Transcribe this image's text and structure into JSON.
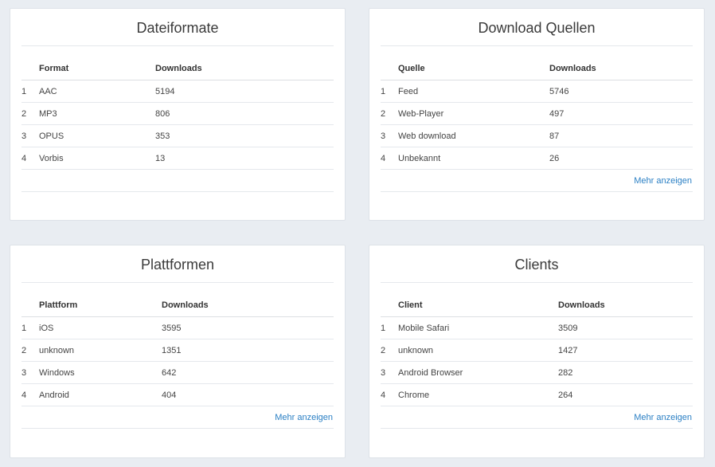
{
  "cards": [
    {
      "title": "Dateiformate",
      "columns": [
        "Format",
        "Downloads"
      ],
      "rows": [
        {
          "rank": "1",
          "name": "AAC",
          "downloads": "5194"
        },
        {
          "rank": "2",
          "name": "MP3",
          "downloads": "806"
        },
        {
          "rank": "3",
          "name": "OPUS",
          "downloads": "353"
        },
        {
          "rank": "4",
          "name": "Vorbis",
          "downloads": "13"
        }
      ],
      "more_label": ""
    },
    {
      "title": "Download Quellen",
      "columns": [
        "Quelle",
        "Downloads"
      ],
      "rows": [
        {
          "rank": "1",
          "name": "Feed",
          "downloads": "5746"
        },
        {
          "rank": "2",
          "name": "Web-Player",
          "downloads": "497"
        },
        {
          "rank": "3",
          "name": "Web download",
          "downloads": "87"
        },
        {
          "rank": "4",
          "name": "Unbekannt",
          "downloads": "26"
        }
      ],
      "more_label": "Mehr anzeigen"
    },
    {
      "title": "Plattformen",
      "columns": [
        "Plattform",
        "Downloads"
      ],
      "rows": [
        {
          "rank": "1",
          "name": "iOS",
          "downloads": "3595"
        },
        {
          "rank": "2",
          "name": "unknown",
          "downloads": "1351"
        },
        {
          "rank": "3",
          "name": "Windows",
          "downloads": "642"
        },
        {
          "rank": "4",
          "name": "Android",
          "downloads": "404"
        }
      ],
      "more_label": "Mehr anzeigen"
    },
    {
      "title": "Clients",
      "columns": [
        "Client",
        "Downloads"
      ],
      "rows": [
        {
          "rank": "1",
          "name": "Mobile Safari",
          "downloads": "3509"
        },
        {
          "rank": "2",
          "name": "unknown",
          "downloads": "1427"
        },
        {
          "rank": "3",
          "name": "Android Browser",
          "downloads": "282"
        },
        {
          "rank": "4",
          "name": "Chrome",
          "downloads": "264"
        }
      ],
      "more_label": "Mehr anzeigen"
    }
  ],
  "colors": {
    "background": "#e9edf2",
    "card": "#ffffff",
    "link": "#2a7fc4"
  }
}
